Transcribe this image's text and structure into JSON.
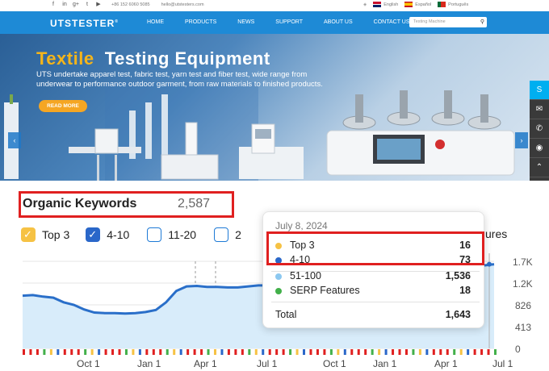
{
  "site": {
    "social_icons": [
      "facebook-icon",
      "linkedin-icon",
      "google-plus-icon",
      "twitter-icon",
      "youtube-icon"
    ],
    "phone": "+86 152 6060 5085",
    "email": "hello@utstesters.com",
    "languages": [
      {
        "name": "English",
        "flag": "flag-uk"
      },
      {
        "name": "Español",
        "flag": "flag-spain"
      },
      {
        "name": "Português",
        "flag": "flag-portugal"
      }
    ],
    "logo": "UTSTESTER",
    "logo_mark": "®",
    "menu": [
      "HOME",
      "PRODUCTS",
      "NEWS",
      "SUPPORT",
      "ABOUT US",
      "CONTACT US"
    ],
    "search_placeholder": "Testing Machine",
    "banner": {
      "title_a": "Textile",
      "title_b": "Testing Equipment",
      "subtitle": "UTS undertake apparel test, fabric test, yarn test and fiber test, wide range from underwear to performance outdoor garment, from raw materials to finished products.",
      "read_more": "READ MORE",
      "prev": "‹",
      "next": "›"
    },
    "sidebar_icons": [
      "skype-icon",
      "email-icon",
      "phone-icon",
      "whatsapp-icon",
      "scroll-top-icon"
    ],
    "colors": {
      "nav": "#1e8ad6",
      "accent": "#f5a623"
    }
  },
  "semrush": {
    "title": "Organic Keywords",
    "count": "2,587",
    "filters": [
      {
        "label": "Top 3",
        "state": "checked-yellow"
      },
      {
        "label": "4-10",
        "state": "checked-blue"
      },
      {
        "label": "11-20",
        "state": "unchecked"
      },
      {
        "label": "2",
        "state": "unchecked"
      },
      {
        "label": "ures",
        "state": "partial"
      }
    ],
    "tooltip": {
      "date": "July 8, 2024",
      "rows": [
        {
          "label": "Top 3",
          "value": "16",
          "color": "#f6c244"
        },
        {
          "label": "4-10",
          "value": "73",
          "color": "#2a67c9"
        },
        {
          "label": "51-100",
          "value": "1,536",
          "color": "#8cc8f0"
        },
        {
          "label": "SERP Features",
          "value": "18",
          "color": "#42b04a"
        }
      ],
      "total_label": "Total",
      "total_value": "1,643"
    },
    "y_ticks": [
      "1.7K",
      "1.2K",
      "826",
      "413",
      "0"
    ],
    "x_ticks": [
      "Oct 1",
      "Jan 1",
      "Apr 1",
      "Jul 1",
      "Oct 1",
      "Jan 1",
      "Apr 1",
      "Jul 1"
    ]
  },
  "chart_data": {
    "type": "area",
    "title": "Organic Keywords",
    "ylim": [
      0,
      1700
    ],
    "y_ticks": [
      "0",
      "413",
      "826",
      "1.2K",
      "1.7K"
    ],
    "x_ticks": [
      "Oct 1",
      "Jan 1",
      "Apr 1",
      "Jul 1",
      "Oct 1",
      "Jan 1",
      "Apr 1",
      "Jul 1"
    ],
    "series": [
      {
        "name": "Total",
        "values": [
          1030,
          1040,
          1010,
          990,
          900,
          850,
          760,
          700,
          690,
          690,
          680,
          690,
          710,
          750,
          900,
          1120,
          1210,
          1220,
          1200,
          1200,
          1190,
          1190,
          1210,
          1230,
          1230,
          1240,
          1250,
          1260,
          1270,
          1280,
          1290,
          1300,
          1320,
          1330,
          1350,
          1370,
          1390,
          1410,
          1430,
          1450,
          1480,
          1500,
          1530,
          1560,
          1590,
          1620,
          1643
        ]
      }
    ]
  }
}
